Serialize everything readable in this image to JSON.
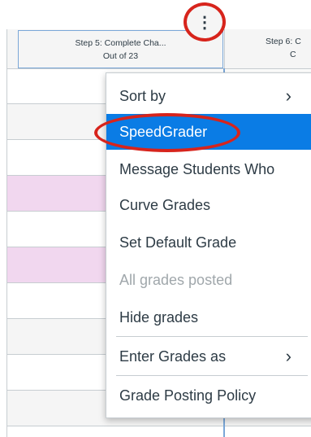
{
  "header": {
    "step5": {
      "line1": "Step 5: Complete Cha...",
      "line2": "Out of 23"
    },
    "step6": {
      "line1": "Step 6: C",
      "line2": "C"
    }
  },
  "kebab_icon": "⋮",
  "menu": {
    "items": [
      {
        "label": "Sort by",
        "submenu": true
      },
      {
        "label": "SpeedGrader",
        "selected": true
      },
      {
        "label": "Message Students Who"
      },
      {
        "label": "Curve Grades"
      },
      {
        "label": "Set Default Grade"
      },
      {
        "label": "All grades posted",
        "disabled": true
      },
      {
        "label": "Hide grades"
      },
      {
        "label": "Enter Grades as",
        "submenu": true
      },
      {
        "label": "Grade Posting Policy"
      }
    ],
    "chevron_icon": "›"
  },
  "colors": {
    "selected": "#0a7ce5",
    "highlight": "#d7241c",
    "pink_row": "#f1d7ef",
    "text": "#2d3b45"
  }
}
